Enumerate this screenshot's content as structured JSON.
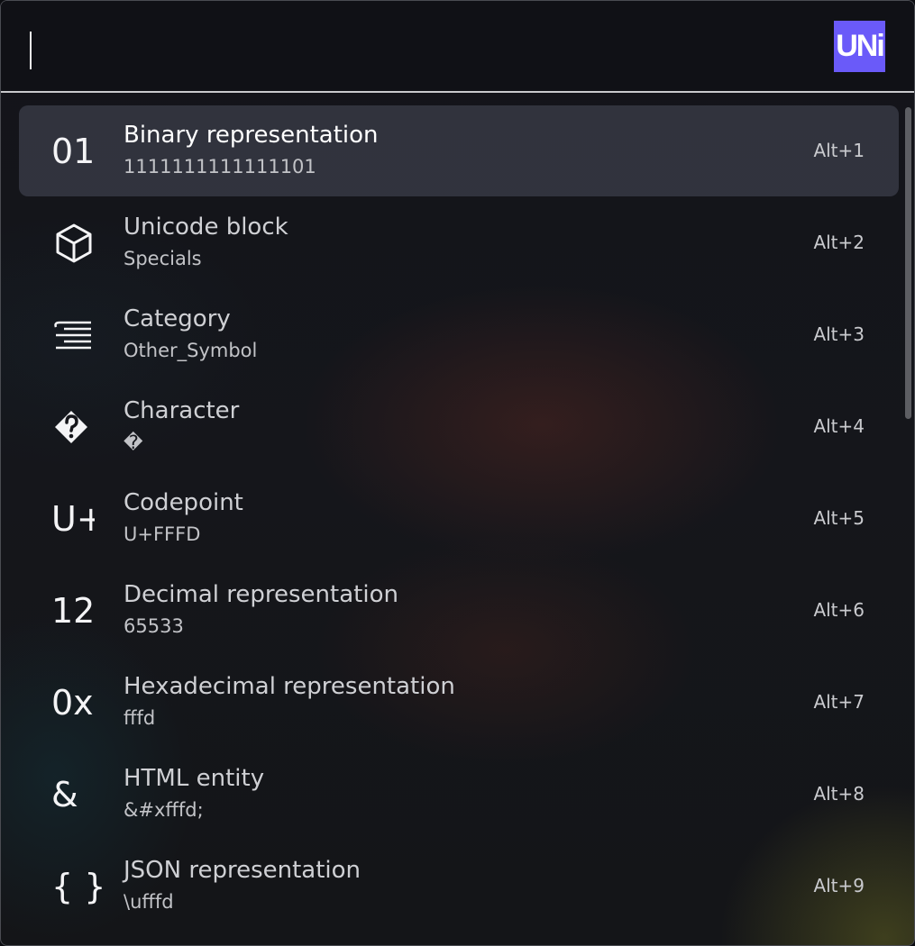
{
  "app": {
    "logo_text": "UNi",
    "accent": "#6a5af9"
  },
  "search": {
    "value": ""
  },
  "results": [
    {
      "icon": "binary-icon",
      "icon_text": "01",
      "title": "Binary representation",
      "subtitle": "1111111111111101",
      "shortcut": "Alt+1",
      "selected": true
    },
    {
      "icon": "cube-icon",
      "icon_text": "",
      "title": "Unicode block",
      "subtitle": "Specials",
      "shortcut": "Alt+2",
      "selected": false
    },
    {
      "icon": "category-lines-icon",
      "icon_text": "",
      "title": "Category",
      "subtitle": "Other_Symbol",
      "shortcut": "Alt+3",
      "selected": false
    },
    {
      "icon": "replacement-char-icon",
      "icon_text": "",
      "title": "Character",
      "subtitle": "�",
      "shortcut": "Alt+4",
      "selected": false
    },
    {
      "icon": "codepoint-icon",
      "icon_text": "U+",
      "title": "Codepoint",
      "subtitle": "U+FFFD",
      "shortcut": "Alt+5",
      "selected": false
    },
    {
      "icon": "decimal-icon",
      "icon_text": "12",
      "title": "Decimal representation",
      "subtitle": "65533",
      "shortcut": "Alt+6",
      "selected": false
    },
    {
      "icon": "hex-icon",
      "icon_text": "0x",
      "title": "Hexadecimal representation",
      "subtitle": "fffd",
      "shortcut": "Alt+7",
      "selected": false
    },
    {
      "icon": "ampersand-icon",
      "icon_text": "&",
      "title": "HTML entity",
      "subtitle": "&#xfffd;",
      "shortcut": "Alt+8",
      "selected": false
    },
    {
      "icon": "braces-icon",
      "icon_text": "{ }",
      "title": "JSON representation",
      "subtitle": "\\ufffd",
      "shortcut": "Alt+9",
      "selected": false
    }
  ]
}
